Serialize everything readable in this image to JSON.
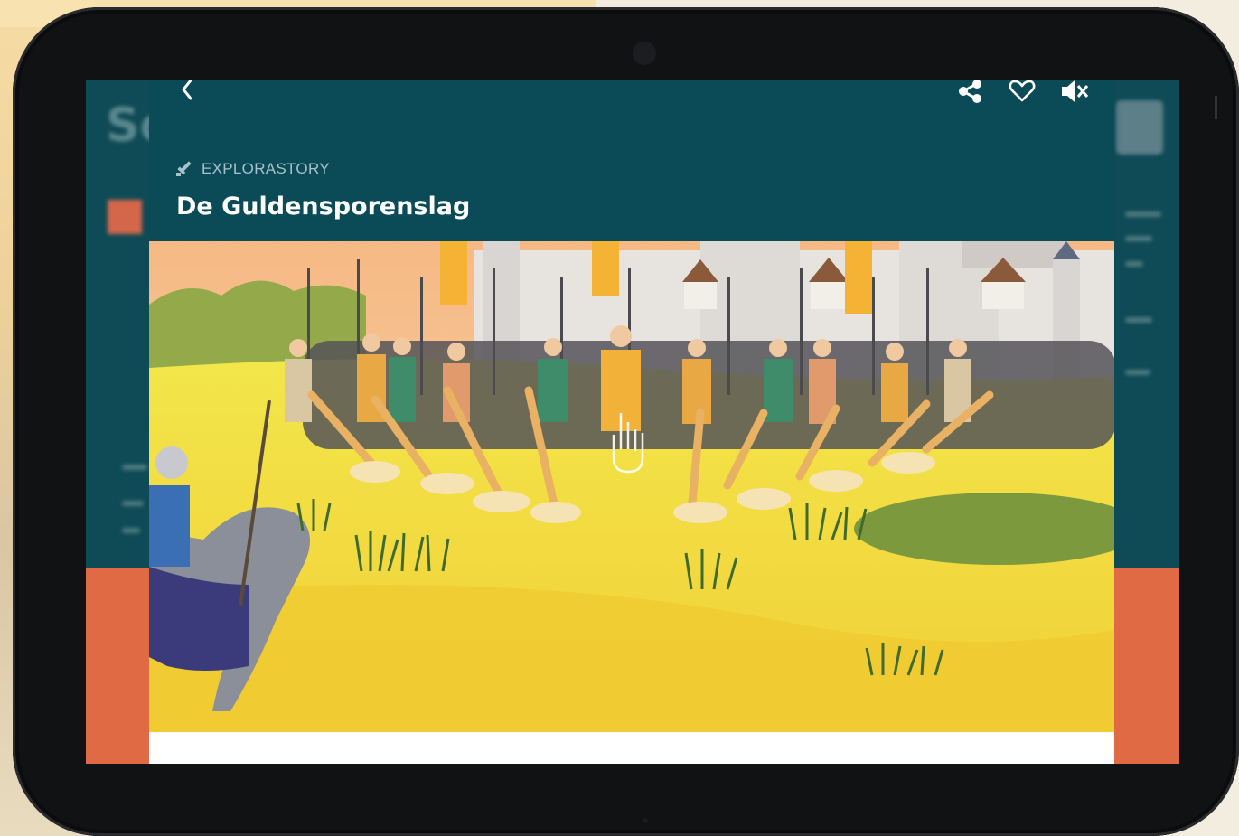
{
  "story": {
    "category": "EXPLORASTORY",
    "title": "De Guldensporenslag"
  },
  "toolbar": {
    "back": "back-icon",
    "share": "share-icon",
    "favorite": "heart-icon",
    "mute": "speaker-muted-icon"
  },
  "background_app": {
    "heading_fragment": "Sc"
  },
  "colors": {
    "header": "#0b4b57",
    "accent_orange": "#df6a44",
    "grass": "#f2da3a",
    "sky": "#f6c48c"
  }
}
